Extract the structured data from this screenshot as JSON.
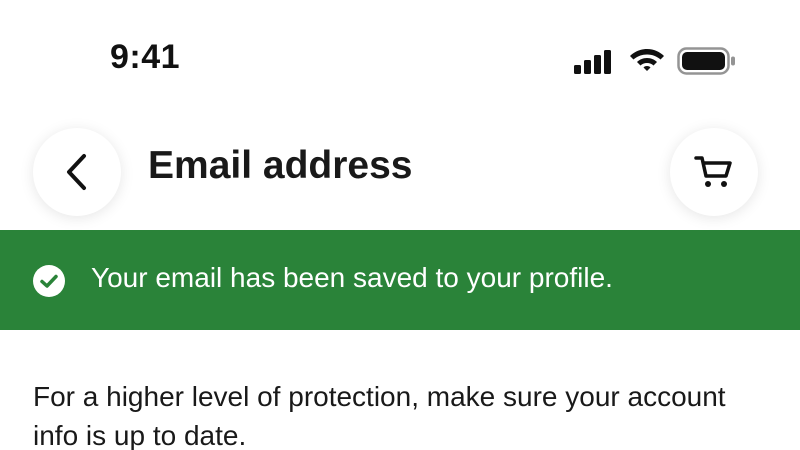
{
  "status_bar": {
    "time": "9:41",
    "signal_icon": "cellular-signal-icon",
    "wifi_icon": "wifi-icon",
    "battery_icon": "battery-full-icon"
  },
  "header": {
    "back_icon": "chevron-left-icon",
    "title": "Email address",
    "cart_icon": "cart-icon"
  },
  "banner": {
    "icon": "check-circle-icon",
    "message": "Your email has been saved to your profile.",
    "background_color": "#2a8339"
  },
  "main": {
    "info_text": "For a higher level of protection, make sure your account info is up to date."
  }
}
